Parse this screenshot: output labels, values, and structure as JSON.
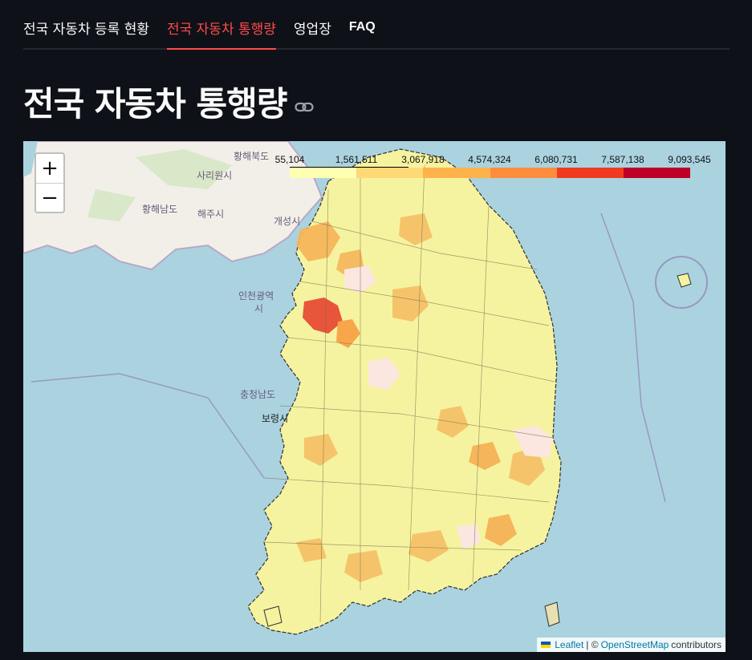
{
  "nav": {
    "tabs": [
      {
        "label": "전국 자동차 등록 현황",
        "active": false
      },
      {
        "label": "전국 자동차 통행량",
        "active": true
      },
      {
        "label": "영업장",
        "active": false
      },
      {
        "label": "FAQ",
        "active": false
      }
    ]
  },
  "page": {
    "title": "전국 자동차 통행량",
    "link_icon": "link-icon"
  },
  "map": {
    "zoom_in_label": "+",
    "zoom_out_label": "−",
    "legend": {
      "ticks": [
        "55,104",
        "1,561,511",
        "3,067,918",
        "4,574,324",
        "6,080,731",
        "7,587,138",
        "9,093,545"
      ],
      "colors": [
        "#ffffb2",
        "#fed976",
        "#feb24c",
        "#fd8d3c",
        "#f03b20",
        "#bd0026"
      ]
    },
    "labels": {
      "hwanghaebukdo": "황해북도",
      "sariwon": "사리원시",
      "hwanghaenamdo": "황해남도",
      "haeju": "해주시",
      "gaeseong": "개성시",
      "incheon_1": "인천광역",
      "incheon_2": "시",
      "chungnam": "충청남도",
      "boryeong": "보령시"
    },
    "attribution": {
      "leaflet": "Leaflet",
      "separator": "| ©",
      "osm": "OpenStreetMap",
      "contributors": "contributors"
    }
  }
}
